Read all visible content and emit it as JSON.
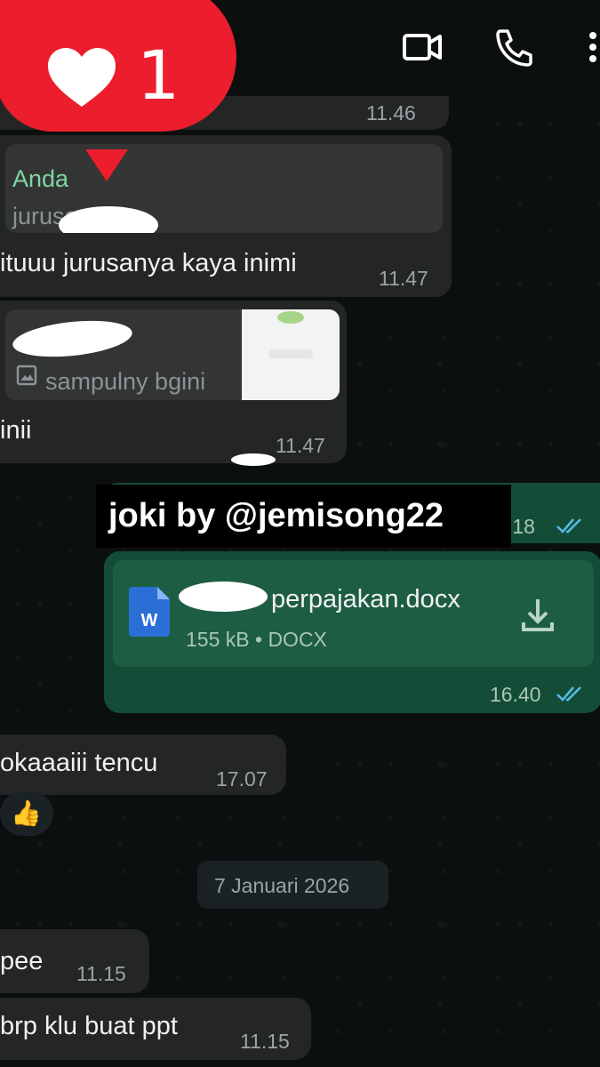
{
  "header": {
    "like_count": "1",
    "icons": [
      "heart-icon",
      "video-call-icon",
      "voice-call-icon",
      "more-options-icon"
    ]
  },
  "messages": [
    {
      "id": "m0",
      "time": "11.46"
    },
    {
      "id": "m1",
      "quote_author": "Anda",
      "quote_text": "jurusan ja",
      "text": "ituuu jurusanya kaya inimi",
      "time": "11.47"
    },
    {
      "id": "m2",
      "quote_caption": "sampulny bgini",
      "text": "inii",
      "time": "11.47"
    },
    {
      "id": "m3",
      "time_partial": ".18"
    },
    {
      "id": "m4",
      "file_name": "perpajakan.docx",
      "file_meta": "155 kB • DOCX",
      "time": "16.40"
    },
    {
      "id": "m5",
      "text": "okaaaiii tencu",
      "time": "17.07",
      "reaction": "👍"
    },
    {
      "id": "m6",
      "text": "pee",
      "time": "11.15"
    },
    {
      "id": "m7",
      "text": "brp klu buat ppt",
      "time": "11.15"
    }
  ],
  "date_separator": "7 Januari 2026",
  "watermark": "joki by @jemisong22",
  "colors": {
    "incoming": "#242626",
    "outgoing": "#144d37",
    "accent_green": "#7fd6a3",
    "tick_blue": "#53bdeb",
    "badge_red": "#ec1d2c"
  }
}
